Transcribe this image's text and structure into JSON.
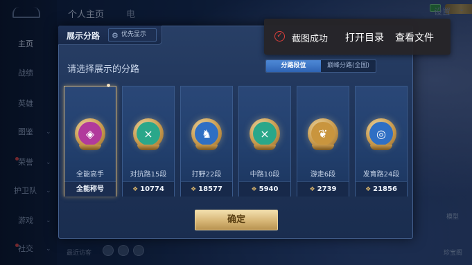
{
  "top_bar": {
    "tabs": [
      "个人主页",
      "电"
    ],
    "settings_label": "设置"
  },
  "left_nav": {
    "items": [
      "主页",
      "战绩",
      "英雄",
      "图鉴",
      "荣誉",
      "护卫队",
      "游戏",
      "社交"
    ]
  },
  "bottom_strip": {
    "text": "最近访客"
  },
  "side_buttons": [
    "模型",
    "珍宝阁"
  ],
  "modal": {
    "title": "展示分路",
    "priority_button": "优先显示",
    "heading": "请选择展示的分路",
    "toggle": {
      "options": [
        "分路段位",
        "巅峰分路(全国)"
      ],
      "selected": "分路段位"
    },
    "cards": [
      {
        "lane": "全能高手",
        "stat": "全能称号",
        "selected": true,
        "color": "#b13a9c",
        "icon": "emblem-icon"
      },
      {
        "lane": "对抗路15段",
        "stat": "10774",
        "selected": false,
        "color": "#2aa78a",
        "icon": "crossed-swords-icon"
      },
      {
        "lane": "打野22段",
        "stat": "18577",
        "selected": false,
        "color": "#2f6fc4",
        "icon": "wolf-icon"
      },
      {
        "lane": "中路10段",
        "stat": "5940",
        "selected": false,
        "color": "#2aa78a",
        "icon": "crossed-swords-icon"
      },
      {
        "lane": "游走6段",
        "stat": "2739",
        "selected": false,
        "color": "#c9953e",
        "icon": "wings-icon"
      },
      {
        "lane": "发育路24段",
        "stat": "21856",
        "selected": false,
        "color": "#2f6fc4",
        "icon": "target-icon"
      }
    ],
    "confirm_label": "确定"
  },
  "toast": {
    "message": "截图成功",
    "open_folder": "打开目录",
    "view_file": "查看文件",
    "accent": "#e0403c"
  }
}
